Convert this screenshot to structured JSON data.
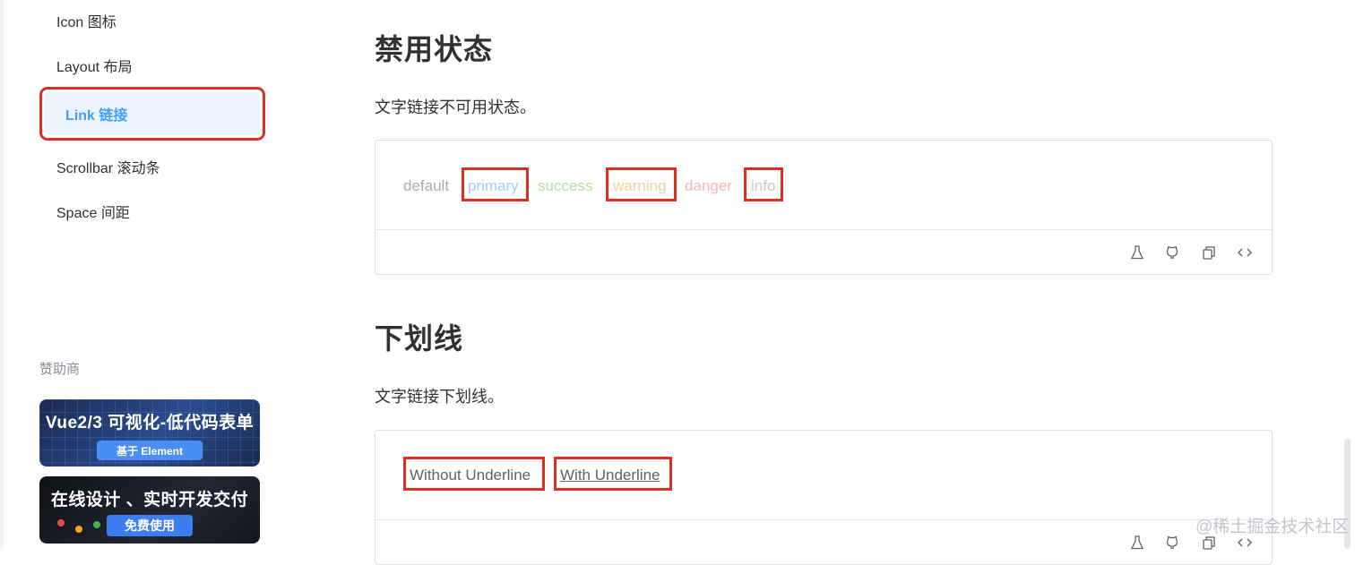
{
  "sidebar": {
    "items": [
      {
        "label": "Icon 图标"
      },
      {
        "label": "Layout 布局"
      },
      {
        "label": "Link 链接",
        "active": true
      },
      {
        "label": "Scrollbar 滚动条"
      },
      {
        "label": "Space 间距"
      }
    ],
    "sponsor_title": "赞助商",
    "banners": [
      {
        "title": "Vue2/3 可视化-低代码表单",
        "button": "基于 Element"
      },
      {
        "title": "在线设计 、实时开发交付",
        "button": "免费使用"
      }
    ]
  },
  "sections": [
    {
      "title": "禁用状态",
      "description": "文字链接不可用状态。",
      "links": [
        "default",
        "primary",
        "success",
        "warning",
        "danger",
        "info"
      ]
    },
    {
      "title": "下划线",
      "description": "文字链接下划线。",
      "links": [
        "Without Underline",
        "With Underline"
      ]
    }
  ],
  "toolbar_icons": [
    "flask-icon",
    "github-icon",
    "copy-icon",
    "code-icon"
  ],
  "watermark": "@稀土掘金技术社区",
  "colors": {
    "accent": "#409eff",
    "highlight": "#e02e22",
    "disabled_default": "#a8abb2",
    "disabled_primary": "#a0cfff",
    "disabled_success": "#b3e19d",
    "disabled_warning": "#f3d19e",
    "disabled_danger": "#fab6b6",
    "disabled_info": "#c8c9cc"
  }
}
